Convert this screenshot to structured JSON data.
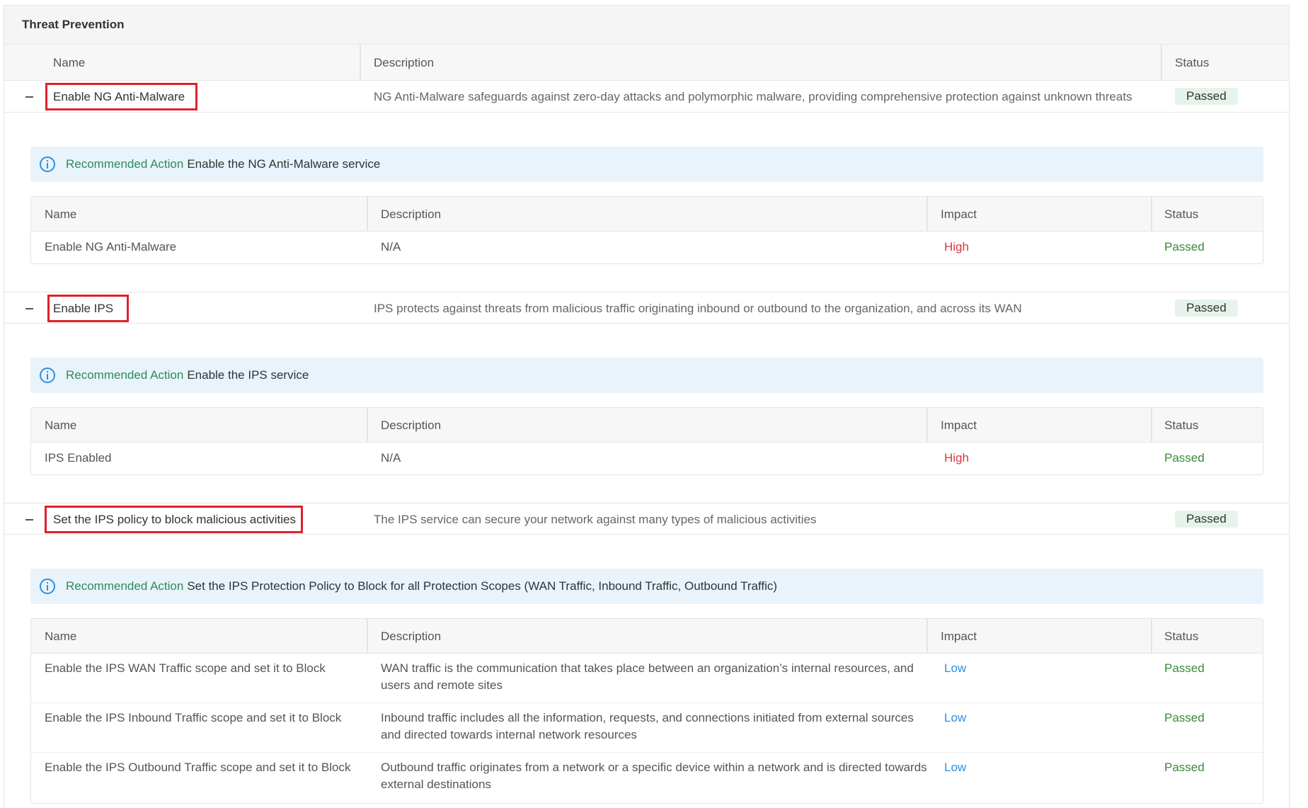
{
  "panel": {
    "title": "Threat Prevention"
  },
  "table": {
    "headers": {
      "name": "Name",
      "description": "Description",
      "status": "Status"
    }
  },
  "checks": [
    {
      "name": "Enable NG Anti-Malware",
      "description": "NG Anti-Malware safeguards against zero-day attacks and polymorphic malware, providing comprehensive protection against unknown threats",
      "status": "Passed",
      "recommended_label": "Recommended Action",
      "recommended_text": "Enable the NG Anti-Malware service",
      "sub_headers": {
        "name": "Name",
        "description": "Description",
        "impact": "Impact",
        "status": "Status"
      },
      "rows": [
        {
          "name": "Enable NG Anti-Malware",
          "description_1": "N/A",
          "description_2": "",
          "impact": "High",
          "status": "Passed"
        }
      ]
    },
    {
      "name": "Enable IPS",
      "description": "IPS protects against threats from malicious traffic originating inbound or outbound to the organization, and across its WAN",
      "status": "Passed",
      "recommended_label": "Recommended Action",
      "recommended_text": "Enable the IPS service",
      "sub_headers": {
        "name": "Name",
        "description": "Description",
        "impact": "Impact",
        "status": "Status"
      },
      "rows": [
        {
          "name": "IPS Enabled",
          "description_1": "N/A",
          "description_2": "",
          "impact": "High",
          "status": "Passed"
        }
      ]
    },
    {
      "name": "Set the IPS policy to block malicious activities",
      "description": "The IPS service can secure your network against many types of malicious activities",
      "status": "Passed",
      "recommended_label": "Recommended Action",
      "recommended_text": "Set the IPS Protection Policy to Block for all Protection Scopes (WAN Traffic, Inbound Traffic, Outbound Traffic)",
      "sub_headers": {
        "name": "Name",
        "description": "Description",
        "impact": "Impact",
        "status": "Status"
      },
      "rows": [
        {
          "name": "Enable the IPS WAN Traffic scope and set it to Block",
          "description_1": "WAN traffic is the communication that takes place between an organization’s internal resources, and",
          "description_2": "users and remote sites",
          "impact": "Low",
          "status": "Passed"
        },
        {
          "name": "Enable the IPS Inbound Traffic scope and set it to Block",
          "description_1": "Inbound traffic includes all the information, requests, and connections initiated from external sources",
          "description_2": "and directed towards internal network resources",
          "impact": "Low",
          "status": "Passed"
        },
        {
          "name": "Enable the IPS Outbound Traffic scope and set it to Block",
          "description_1": "Outbound traffic originates from a network or a specific device within a network and is directed towards",
          "description_2": "external destinations",
          "impact": "Low",
          "status": "Passed"
        }
      ]
    }
  ],
  "colors": {
    "highlight": "#e0202f",
    "impact_high": "#d9363e",
    "impact_low": "#2d8fe0",
    "status_passed": "#3a8a3a",
    "rec_label": "#2e8b57",
    "rec_bg": "#e8f3fc",
    "badge_bg": "#e6f3ea"
  }
}
